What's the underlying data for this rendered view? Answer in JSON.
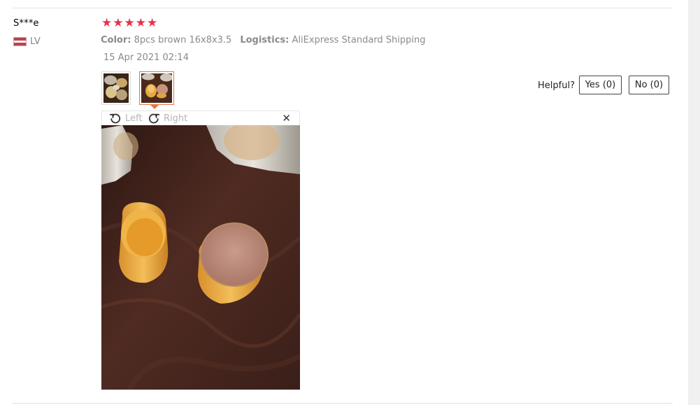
{
  "review": {
    "reviewer_name": "S***e",
    "country_code": "LV",
    "rating_stars": 5,
    "star_glyph": "★",
    "attributes": {
      "color_label": "Color:",
      "color_value": "8pcs brown 16x8x3.5",
      "logistics_label": "Logistics:",
      "logistics_value": "AliExpress Standard Shipping"
    },
    "date": "15 Apr 2021 02:14"
  },
  "helpful": {
    "label": "Helpful?",
    "yes_label": "Yes (0)",
    "no_label": "No (0)"
  },
  "image_viewer": {
    "rotate_left_label": "Left",
    "rotate_right_label": "Right",
    "close_glyph": "✕"
  },
  "icons": [
    "rotate-left-icon",
    "rotate-right-icon",
    "close-icon",
    "star-icon",
    "latvia-flag-icon"
  ],
  "colors": {
    "star": "#e8324b",
    "selected_thumb_border": "#e0794a",
    "muted_text": "#8a8a8a"
  }
}
